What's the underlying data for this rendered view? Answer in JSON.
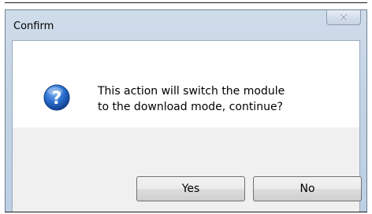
{
  "window": {
    "title": "Confirm",
    "close_glyph": "x"
  },
  "message": {
    "line1": "This action will switch the module",
    "line2": "to the download mode, continue?",
    "icon": "question-icon"
  },
  "buttons": {
    "yes_label": "Yes",
    "no_label": "No"
  },
  "colors": {
    "icon_blue": "#1f5fbf",
    "frame_blue": "#c3d3e4"
  }
}
